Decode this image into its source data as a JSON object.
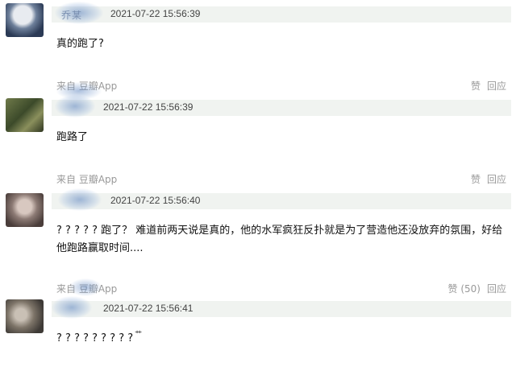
{
  "comments": [
    {
      "name": "乔某",
      "time": "2021-07-22 15:56:39",
      "content": "真的跑了?"
    },
    {
      "name": "",
      "time": "2021-07-22 15:56:39",
      "content": "跑路了"
    },
    {
      "name": "",
      "time": "2021-07-22 15:56:40",
      "content": "? ? ? ? ? 跑了？ 难道前两天说是真的，他的水军疯狂反扑就是为了营造他还没放弃的氛围，好给他跑路赢取时间...."
    },
    {
      "name": "",
      "time": "2021-07-22 15:56:41",
      "content": "? ? ? ? ? ? ? ? ?",
      "content_suffix": "艹"
    }
  ],
  "footers": [
    {
      "source": "来自 豆瓣App",
      "like": "赞",
      "reply": "回应"
    },
    {
      "source": "来自 豆瓣App",
      "like": "赞",
      "reply": "回应"
    },
    {
      "source": "来自 豆瓣App",
      "like": "赞 (50)",
      "reply": "回应"
    }
  ],
  "colors": {
    "meta_bar": "#f0f3f0",
    "muted_text": "#999999"
  }
}
